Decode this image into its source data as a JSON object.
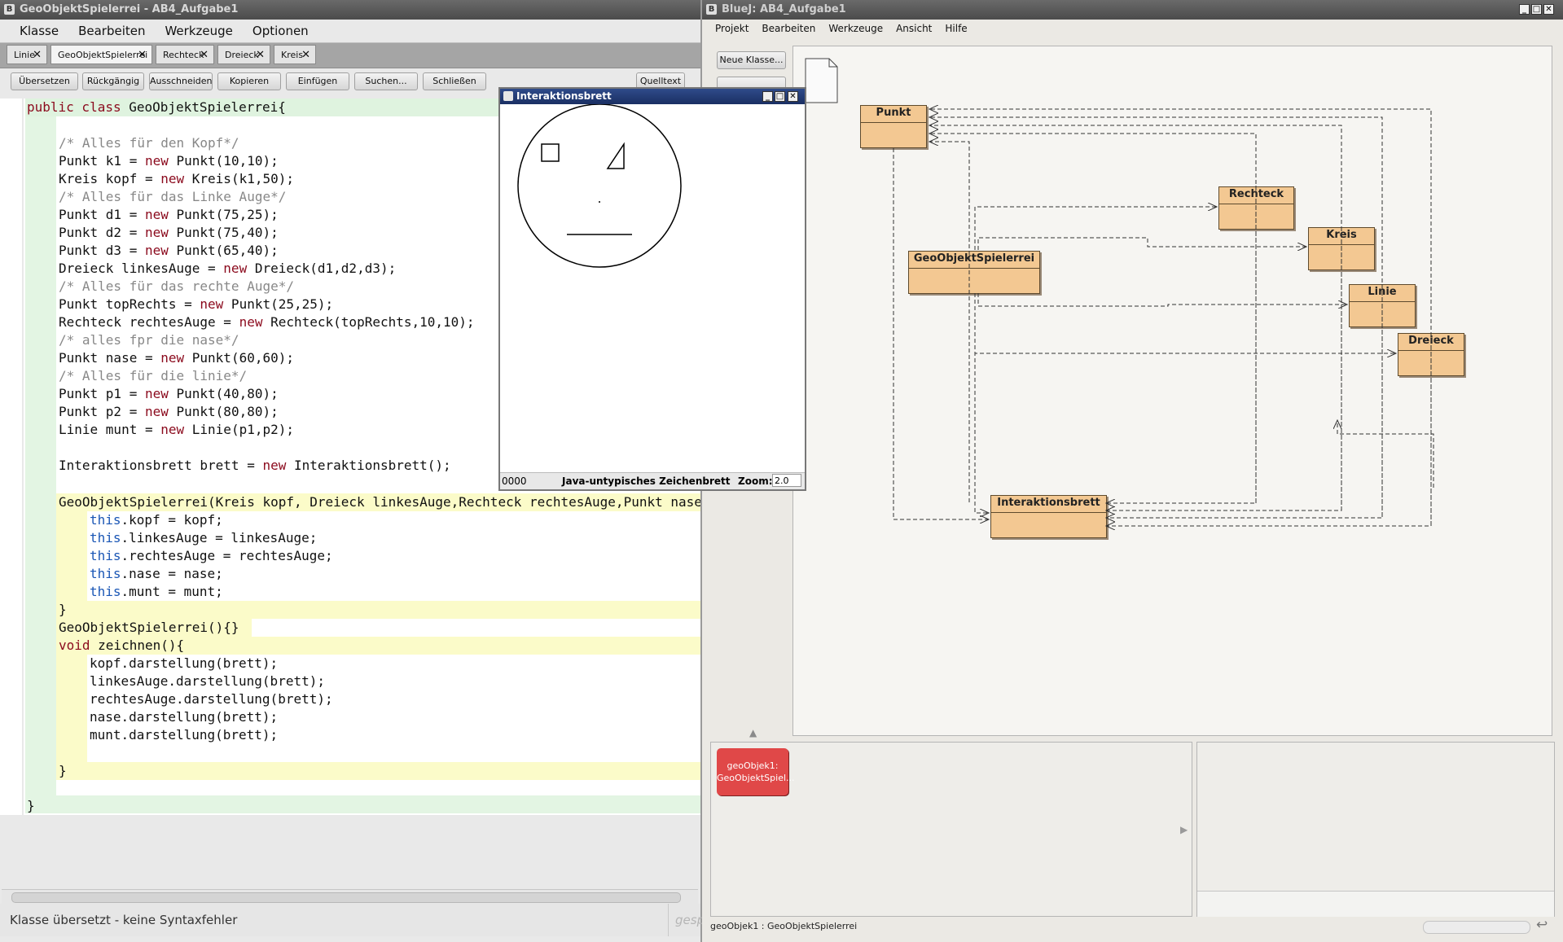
{
  "editor": {
    "title": "GeoObjektSpielerrei - AB4_Aufgabe1",
    "menu": [
      "Klasse",
      "Bearbeiten",
      "Werkzeuge",
      "Optionen"
    ],
    "tabs": [
      "Linie",
      "GeoObjektSpielerrei",
      "Rechteck",
      "Dreieck",
      "Kreis"
    ],
    "toolbar": [
      "Übersetzen",
      "Rückgängig",
      "Ausschneiden",
      "Kopieren",
      "Einfügen",
      "Suchen...",
      "Schließen"
    ],
    "view_selector": "Quelltext",
    "code_lines": [
      "public class GeoObjektSpielerrei{",
      "",
      "/* Alles für den Kopf*/",
      "Punkt k1 = new Punkt(10,10);",
      "Kreis kopf = new Kreis(k1,50);",
      "/* Alles für das Linke Auge*/",
      "Punkt d1 = new Punkt(75,25);",
      "Punkt d2 = new Punkt(75,40);",
      "Punkt d3 = new Punkt(65,40);",
      "Dreieck linkesAuge = new Dreieck(d1,d2,d3);",
      "/* Alles für das rechte Auge*/",
      "Punkt topRechts = new Punkt(25,25);",
      "Rechteck rechtesAuge = new Rechteck(topRechts,10,10);",
      "/* alles fpr die nase*/",
      "Punkt nase = new Punkt(60,60);",
      "/* Alles für die linie*/",
      "Punkt p1 = new Punkt(40,80);",
      "Punkt p2 = new Punkt(80,80);",
      "Linie munt = new Linie(p1,p2);",
      "",
      "Interaktionsbrett brett = new Interaktionsbrett();",
      "",
      "GeoObjektSpielerrei(Kreis kopf, Dreieck linkesAuge,Rechteck rechtesAuge,Punkt nase",
      "this.kopf = kopf;",
      "this.linkesAuge = linkesAuge;",
      "this.rechtesAuge = rechtesAuge;",
      "this.nase = nase;",
      "this.munt = munt;",
      "}",
      "GeoObjektSpielerrei(){}",
      "void zeichnen(){",
      "kopf.darstellung(brett);",
      "linkesAuge.darstellung(brett);",
      "rechtesAuge.darstellung(brett);",
      "nase.darstellung(brett);",
      "munt.darstellung(brett);",
      "",
      "}",
      "",
      "}"
    ],
    "status": "Klasse übersetzt - keine Syntaxfehler",
    "status_right": "gespe"
  },
  "interaktionsbrett": {
    "title": "Interaktionsbrett",
    "footer_coords": "0000",
    "footer_label": "Java-untypisches Zeichenbrett",
    "zoom_label": "Zoom:",
    "zoom_value": "2.0"
  },
  "bluej": {
    "title": "BlueJ: AB4_Aufgabe1",
    "menu": [
      "Projekt",
      "Bearbeiten",
      "Werkzeuge",
      "Ansicht",
      "Hilfe"
    ],
    "new_class_button": "Neue Klasse...",
    "classes": [
      "Punkt",
      "Rechteck",
      "Kreis",
      "GeoObjektSpielerrei",
      "Linie",
      "Dreieck",
      "Interaktionsbrett"
    ],
    "object": {
      "line1": "geoObjek1:",
      "line2": "GeoObjektSpiel..."
    },
    "status": "geoObjek1 : GeoObjektSpielerrei",
    "object_color": "#e04848",
    "class_color": "#f3c892"
  }
}
